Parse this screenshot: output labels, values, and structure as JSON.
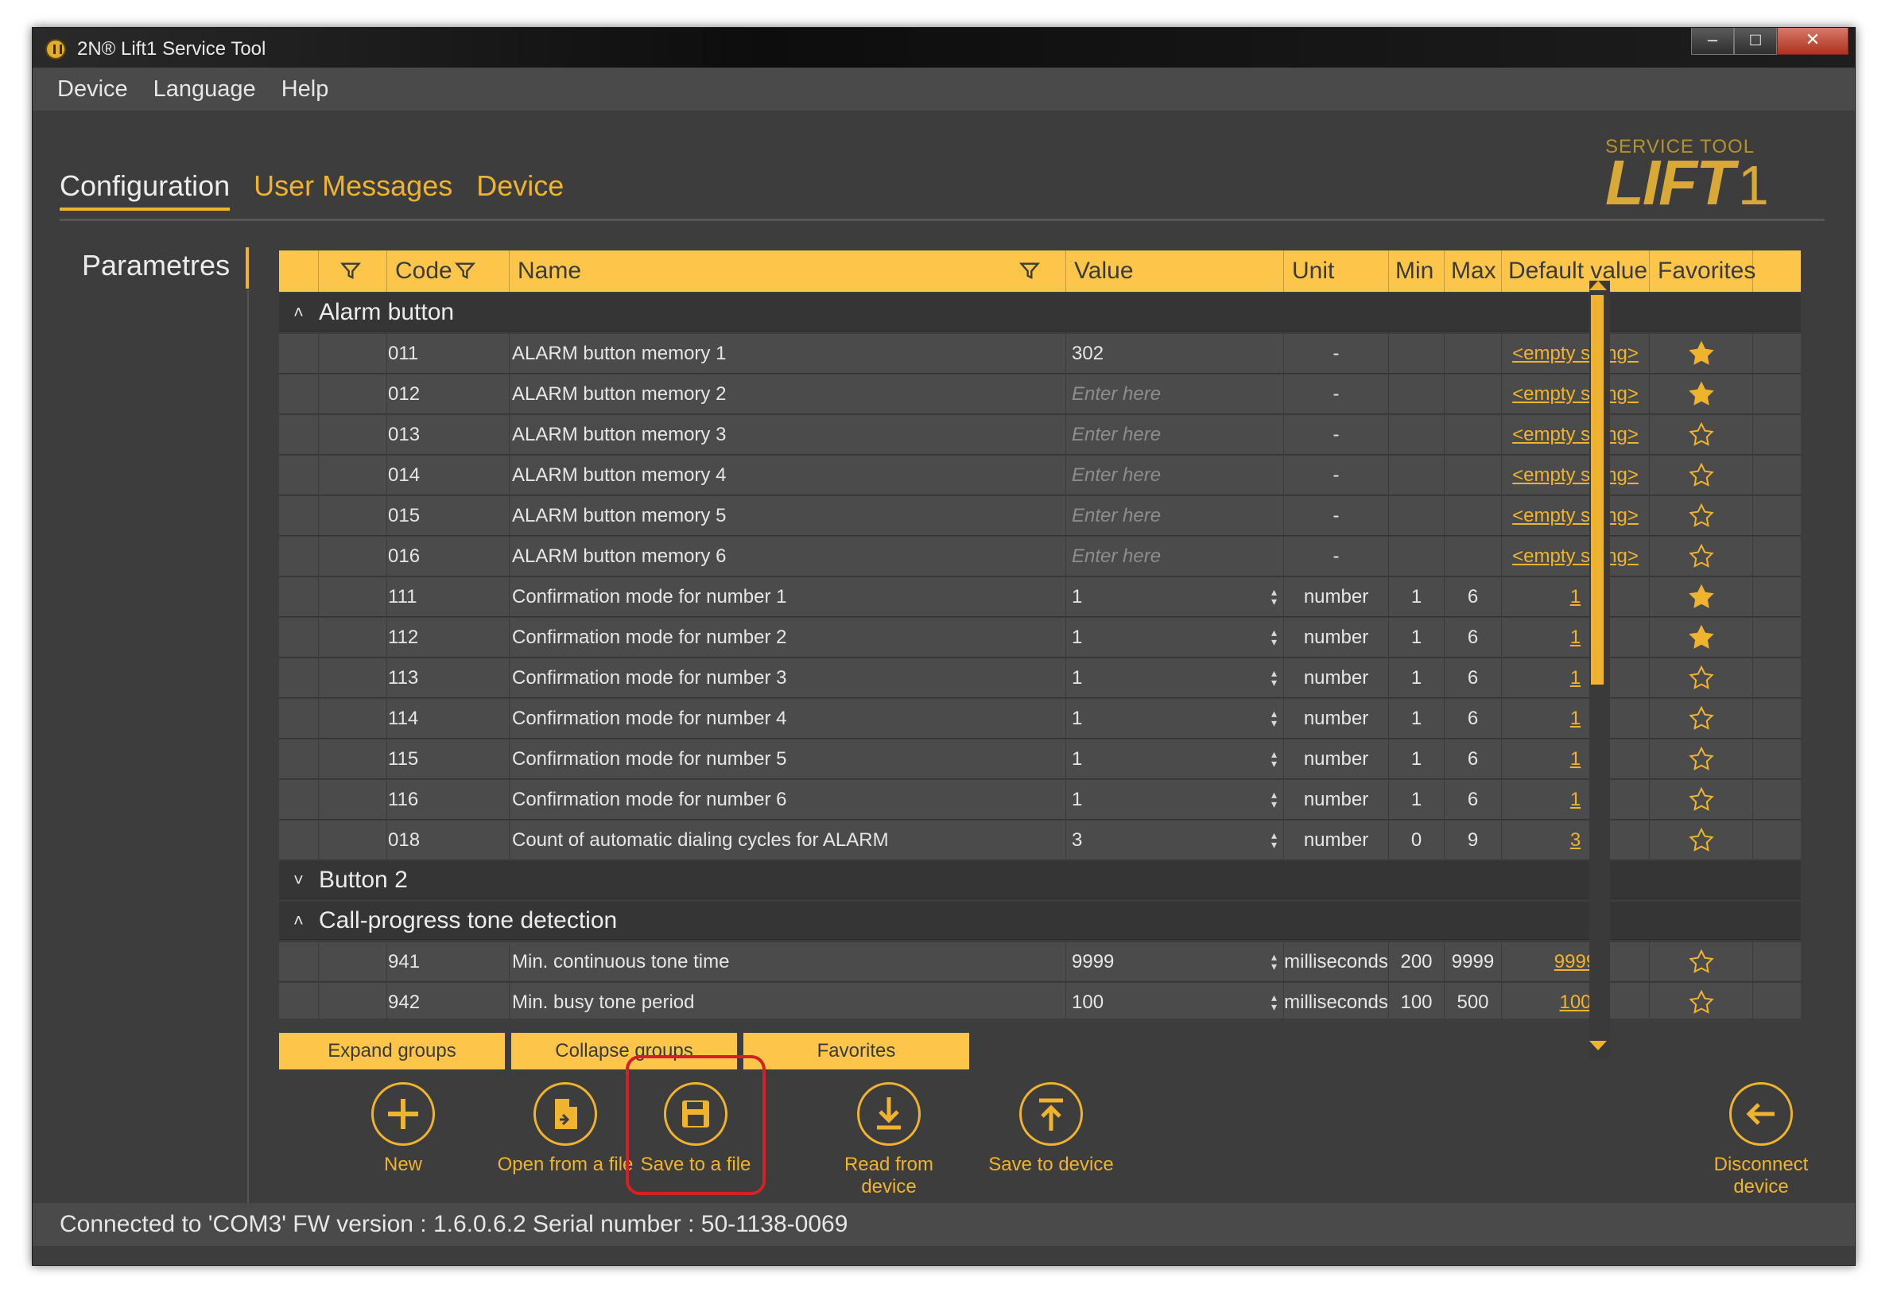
{
  "window": {
    "title": "2N® Lift1 Service Tool"
  },
  "menu": [
    "Device",
    "Language",
    "Help"
  ],
  "tabs": [
    {
      "label": "Configuration",
      "active": true
    },
    {
      "label": "User Messages",
      "active": false
    },
    {
      "label": "Device",
      "active": false
    }
  ],
  "logo": {
    "small": "SERVICE TOOL",
    "big": "LIFT",
    "digit": "1"
  },
  "sidebar": {
    "label": "Parametres"
  },
  "table": {
    "headers": [
      "Code",
      "Name",
      "Value",
      "Unit",
      "Min",
      "Max",
      "Default value",
      "Favorites"
    ],
    "groups": [
      {
        "name": "Alarm button",
        "expanded": true
      },
      {
        "name": "Button 2",
        "expanded": false
      },
      {
        "name": "Call-progress tone detection",
        "expanded": true
      }
    ],
    "rows": [
      {
        "code": "011",
        "name": "ALARM button memory 1",
        "value": "302",
        "placeholder": false,
        "unit": "-",
        "min": "",
        "max": "",
        "default": "<empty string>",
        "favorite": true,
        "edited": true,
        "spinner": false
      },
      {
        "code": "012",
        "name": "ALARM button memory 2",
        "value": "Enter here",
        "placeholder": true,
        "unit": "-",
        "min": "",
        "max": "",
        "default": "<empty string>",
        "favorite": true,
        "edited": false,
        "spinner": false
      },
      {
        "code": "013",
        "name": "ALARM button memory 3",
        "value": "Enter here",
        "placeholder": true,
        "unit": "-",
        "min": "",
        "max": "",
        "default": "<empty string>",
        "favorite": false,
        "edited": false,
        "spinner": false
      },
      {
        "code": "014",
        "name": "ALARM button memory 4",
        "value": "Enter here",
        "placeholder": true,
        "unit": "-",
        "min": "",
        "max": "",
        "default": "<empty string>",
        "favorite": false,
        "edited": false,
        "spinner": false
      },
      {
        "code": "015",
        "name": "ALARM button memory 5",
        "value": "Enter here",
        "placeholder": true,
        "unit": "-",
        "min": "",
        "max": "",
        "default": "<empty string>",
        "favorite": false,
        "edited": false,
        "spinner": false
      },
      {
        "code": "016",
        "name": "ALARM button memory 6",
        "value": "Enter here",
        "placeholder": true,
        "unit": "-",
        "min": "",
        "max": "",
        "default": "<empty string>",
        "favorite": false,
        "edited": false,
        "spinner": false
      },
      {
        "code": "111",
        "name": "Confirmation mode for number 1",
        "value": "1",
        "placeholder": false,
        "unit": "number",
        "min": "1",
        "max": "6",
        "default": "1",
        "favorite": true,
        "edited": false,
        "spinner": true
      },
      {
        "code": "112",
        "name": "Confirmation mode for number 2",
        "value": "1",
        "placeholder": false,
        "unit": "number",
        "min": "1",
        "max": "6",
        "default": "1",
        "favorite": true,
        "edited": false,
        "spinner": true
      },
      {
        "code": "113",
        "name": "Confirmation mode for number 3",
        "value": "1",
        "placeholder": false,
        "unit": "number",
        "min": "1",
        "max": "6",
        "default": "1",
        "favorite": false,
        "edited": false,
        "spinner": true
      },
      {
        "code": "114",
        "name": "Confirmation mode for number 4",
        "value": "1",
        "placeholder": false,
        "unit": "number",
        "min": "1",
        "max": "6",
        "default": "1",
        "favorite": false,
        "edited": false,
        "spinner": true
      },
      {
        "code": "115",
        "name": "Confirmation mode for number 5",
        "value": "1",
        "placeholder": false,
        "unit": "number",
        "min": "1",
        "max": "6",
        "default": "1",
        "favorite": false,
        "edited": false,
        "spinner": true
      },
      {
        "code": "116",
        "name": "Confirmation mode for number 6",
        "value": "1",
        "placeholder": false,
        "unit": "number",
        "min": "1",
        "max": "6",
        "default": "1",
        "favorite": false,
        "edited": false,
        "spinner": true
      },
      {
        "code": "018",
        "name": "Count of automatic dialing cycles for ALARM",
        "value": "3",
        "placeholder": false,
        "unit": "number",
        "min": "0",
        "max": "9",
        "default": "3",
        "favorite": false,
        "edited": false,
        "spinner": true
      },
      {
        "code": "941",
        "name": "Min. continuous tone time",
        "value": "9999",
        "placeholder": false,
        "unit": "milliseconds",
        "min": "200",
        "max": "9999",
        "default": "9999",
        "favorite": false,
        "edited": false,
        "spinner": true
      },
      {
        "code": "942",
        "name": "Min. busy tone period",
        "value": "100",
        "placeholder": false,
        "unit": "milliseconds",
        "min": "100",
        "max": "500",
        "default": "100",
        "favorite": false,
        "edited": false,
        "spinner": true
      }
    ]
  },
  "buttons": {
    "expand": "Expand groups",
    "collapse": "Collapse groups",
    "favorites": "Favorites"
  },
  "actions": {
    "new": "New",
    "open": "Open from a file",
    "save_file": "Save to a file",
    "read_device": [
      "Read from",
      "device"
    ],
    "save_device": "Save to device",
    "disconnect": [
      "Disconnect",
      "device"
    ]
  },
  "status": "Connected to 'COM3'   FW version : 1.6.0.6.2   Serial number : 50-1138-0069",
  "colors": {
    "accent": "#f0b32e",
    "header": "#fdc64b",
    "background": "#3d3d3d",
    "highlight": "#d62027"
  }
}
